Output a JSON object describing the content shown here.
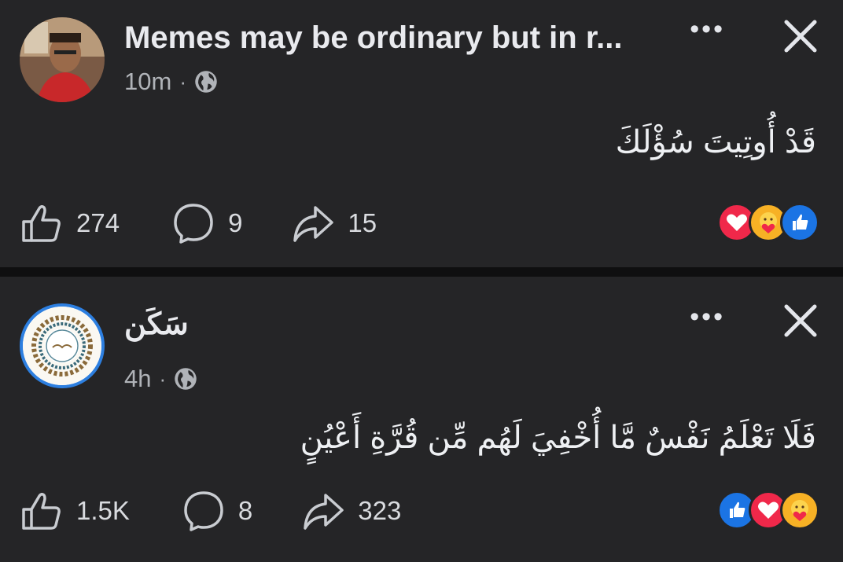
{
  "posts": [
    {
      "author": "Memes may be ordinary but in r...",
      "time": "10m",
      "separator": "·",
      "more": "•••",
      "text": "قَدْ أُوتِيتَ سُؤْلَكَ",
      "likes": "274",
      "comments": "9",
      "shares": "15",
      "reactions": [
        "love-icon",
        "care-icon",
        "like-icon"
      ]
    },
    {
      "author": "سَكَن",
      "time": "4h",
      "separator": "·",
      "more": "•••",
      "text": "فَلَا تَعْلَمُ نَفْسٌ مَّا أُخْفِيَ لَهُم مِّن قُرَّةِ أَعْيُنٍ",
      "likes": "1.5K",
      "comments": "8",
      "shares": "323",
      "reactions": [
        "like-icon",
        "love-icon",
        "care-icon"
      ]
    }
  ],
  "colors": {
    "background": "#252527",
    "divider": "#0f0f10",
    "like": "#1b74e4",
    "love": "#f0284a",
    "care": "#f7b125",
    "story_ring": "#2d7fe0"
  }
}
